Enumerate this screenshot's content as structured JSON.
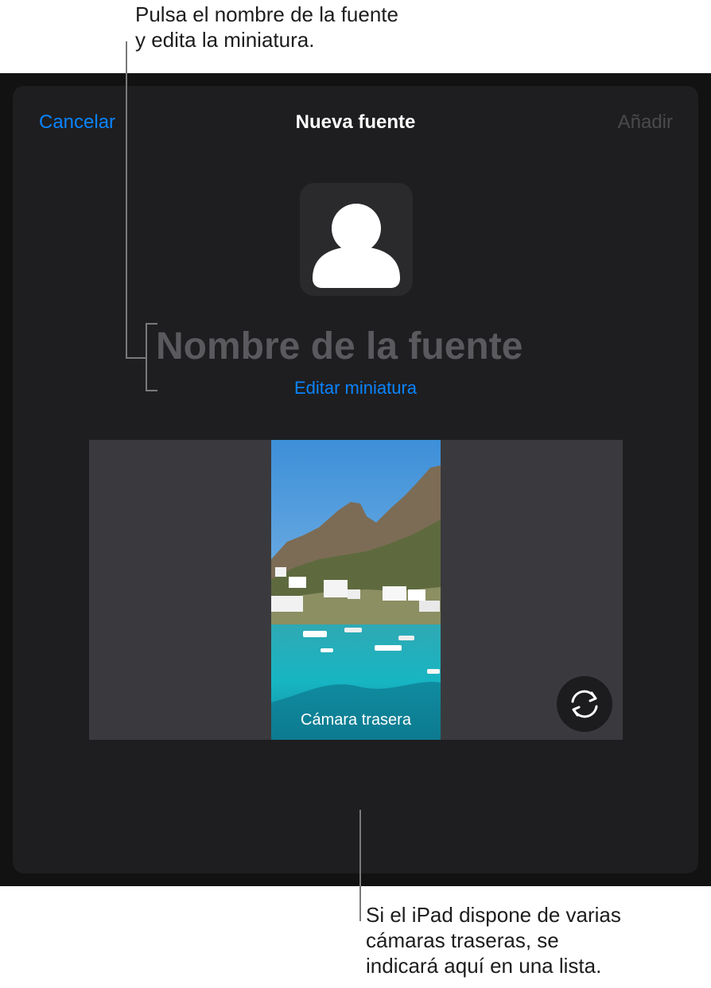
{
  "annotations": {
    "top": "Pulsa el nombre de la fuente\ny edita la miniatura.",
    "bottom": "Si el iPad dispone de varias\ncámaras traseras, se\nindicará aquí en una lista."
  },
  "dialog": {
    "title": "Nueva fuente",
    "cancel_label": "Cancelar",
    "add_label": "Añadir",
    "avatar_icon": "person-silhouette-icon",
    "name_placeholder": "Nombre de la fuente",
    "name_value": "",
    "edit_thumbnail_label": "Editar miniatura"
  },
  "camera": {
    "label": "Cámara trasera",
    "flip_icon": "camera-switch-icon"
  },
  "colors": {
    "accent": "#0a84ff",
    "disabled": "#4a4a4d",
    "sheet_bg": "#1e1e20",
    "panel_bg": "#3a3a3e"
  }
}
